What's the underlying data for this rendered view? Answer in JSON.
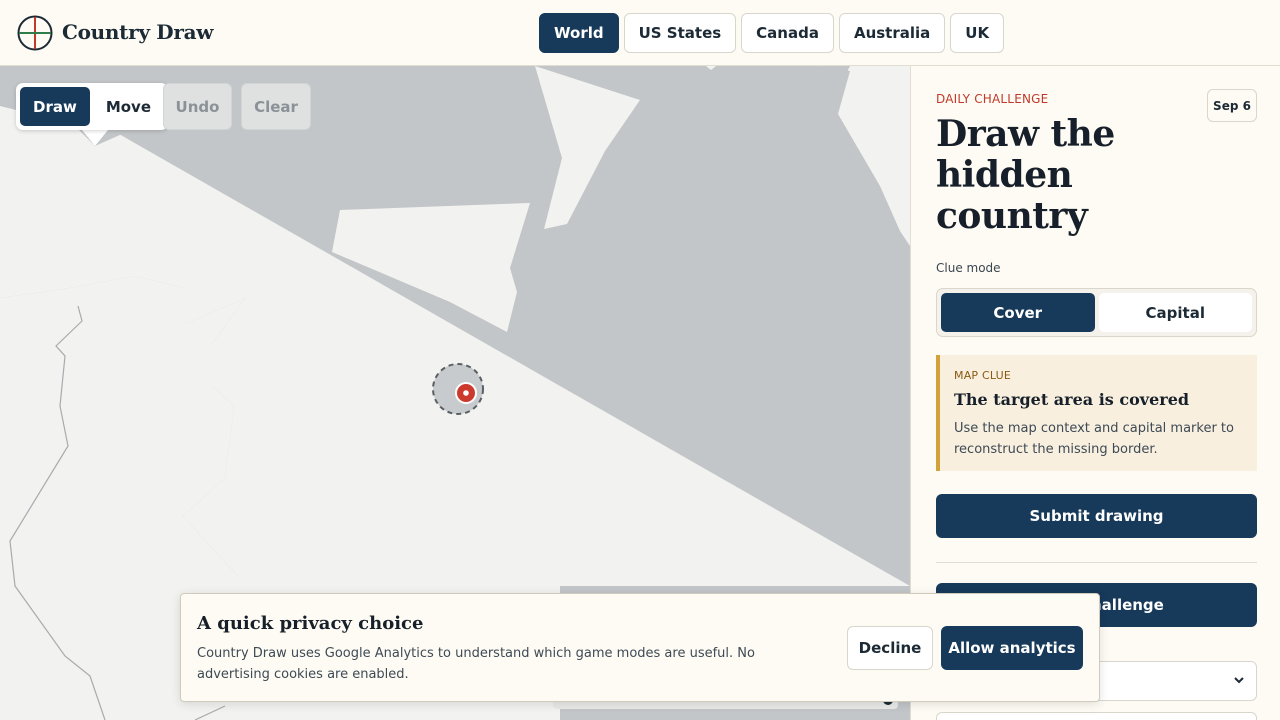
{
  "header": {
    "brand": "Country Draw",
    "regions": [
      "World",
      "US States",
      "Canada",
      "Australia",
      "UK"
    ],
    "active_region": "World"
  },
  "map": {
    "tools": {
      "draw": "Draw",
      "move": "Move"
    },
    "undo": "Undo",
    "clear": "Clear"
  },
  "sidebar": {
    "eyebrow": "DAILY CHALLENGE",
    "date": "Sep 6",
    "title": "Draw the hidden country",
    "clue_mode_label": "Clue mode",
    "modes": {
      "cover": "Cover",
      "capital": "Capital"
    },
    "clue": {
      "tag": "MAP CLUE",
      "title": "The target area is covered",
      "description": "Use the map context and capital marker to reconstruct the missing border."
    },
    "submit": "Submit drawing",
    "challenge_visible": "hallenge"
  },
  "privacy": {
    "title": "A quick privacy choice",
    "text": "Country Draw uses Google Analytics to understand which game modes are useful. No advertising cookies are enabled.",
    "decline": "Decline",
    "allow": "Allow analytics"
  },
  "colors": {
    "navy": "#17395a",
    "cover": "#c2c6c8",
    "land": "#f2f2f0",
    "marker": "#cc3a2e",
    "alert": "#c0392b"
  }
}
